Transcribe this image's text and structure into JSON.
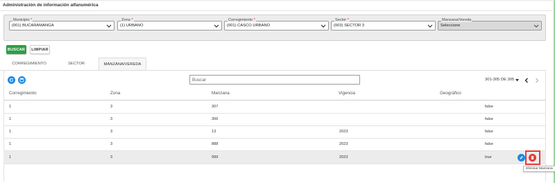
{
  "page": {
    "title": "Administración de información alfanumérica"
  },
  "filters": {
    "municipio": {
      "label": "Municipio",
      "required_mark": "*",
      "value": "(001) BUCARAMANGA",
      "icon": "chevron-down-icon"
    },
    "zona": {
      "label": "Zona",
      "required_mark": "*",
      "value": "(1) URBANO",
      "icon": "chevron-down-icon"
    },
    "corregimiento": {
      "label": "Corregimiento",
      "required_mark": "*",
      "value": "(001) CASCO URBANO",
      "icon": "chevron-down-icon"
    },
    "sector": {
      "label": "Sector",
      "required_mark": "*",
      "value": "(003) SECTOR 3",
      "icon": "chevron-down-icon"
    },
    "manzana": {
      "label": "Manzana/Vereda",
      "value": "Seleccione",
      "disabled": true,
      "icon": "chevron-down-icon"
    }
  },
  "actions": {
    "buscar": "BUSCAR",
    "limpiar": "LIMPIAR"
  },
  "tabs": [
    {
      "label": "CORREGIMIENTO",
      "active": false
    },
    {
      "label": "SECTOR",
      "active": false
    },
    {
      "label": "MANZANA/VEREDA",
      "active": true
    }
  ],
  "toolbar": {
    "refresh_icon": "refresh-icon",
    "save_icon": "save-icon",
    "search_placeholder": "Buscar",
    "pager_text": "301-305 DE 305",
    "prev_icon": "chevron-left-icon",
    "next_icon": "chevron-right-icon"
  },
  "table": {
    "columns": [
      "Corregimiento",
      "Zona",
      "Manzana",
      "Vigencia",
      "Geográfico"
    ],
    "rows": [
      {
        "corregimiento": "1",
        "zona": "3",
        "manzana": "307",
        "vigencia": "",
        "geografico": "false"
      },
      {
        "corregimiento": "1",
        "zona": "3",
        "manzana": "306",
        "vigencia": "",
        "geografico": "false"
      },
      {
        "corregimiento": "1",
        "zona": "3",
        "manzana": "13",
        "vigencia": "2023",
        "geografico": "false"
      },
      {
        "corregimiento": "1",
        "zona": "3",
        "manzana": "888",
        "vigencia": "2023",
        "geografico": "false"
      },
      {
        "corregimiento": "1",
        "zona": "3",
        "manzana": "999",
        "vigencia": "2023",
        "geografico": "true",
        "highlighted": true
      }
    ]
  },
  "row_actions": {
    "edit_icon": "pencil-icon",
    "delete_icon": "trash-icon",
    "delete_tooltip": "Eliminar Manzana"
  },
  "colors": {
    "primary_blue": "#1e88e5",
    "success_green": "#2e9e44",
    "danger_red": "#e53935"
  }
}
